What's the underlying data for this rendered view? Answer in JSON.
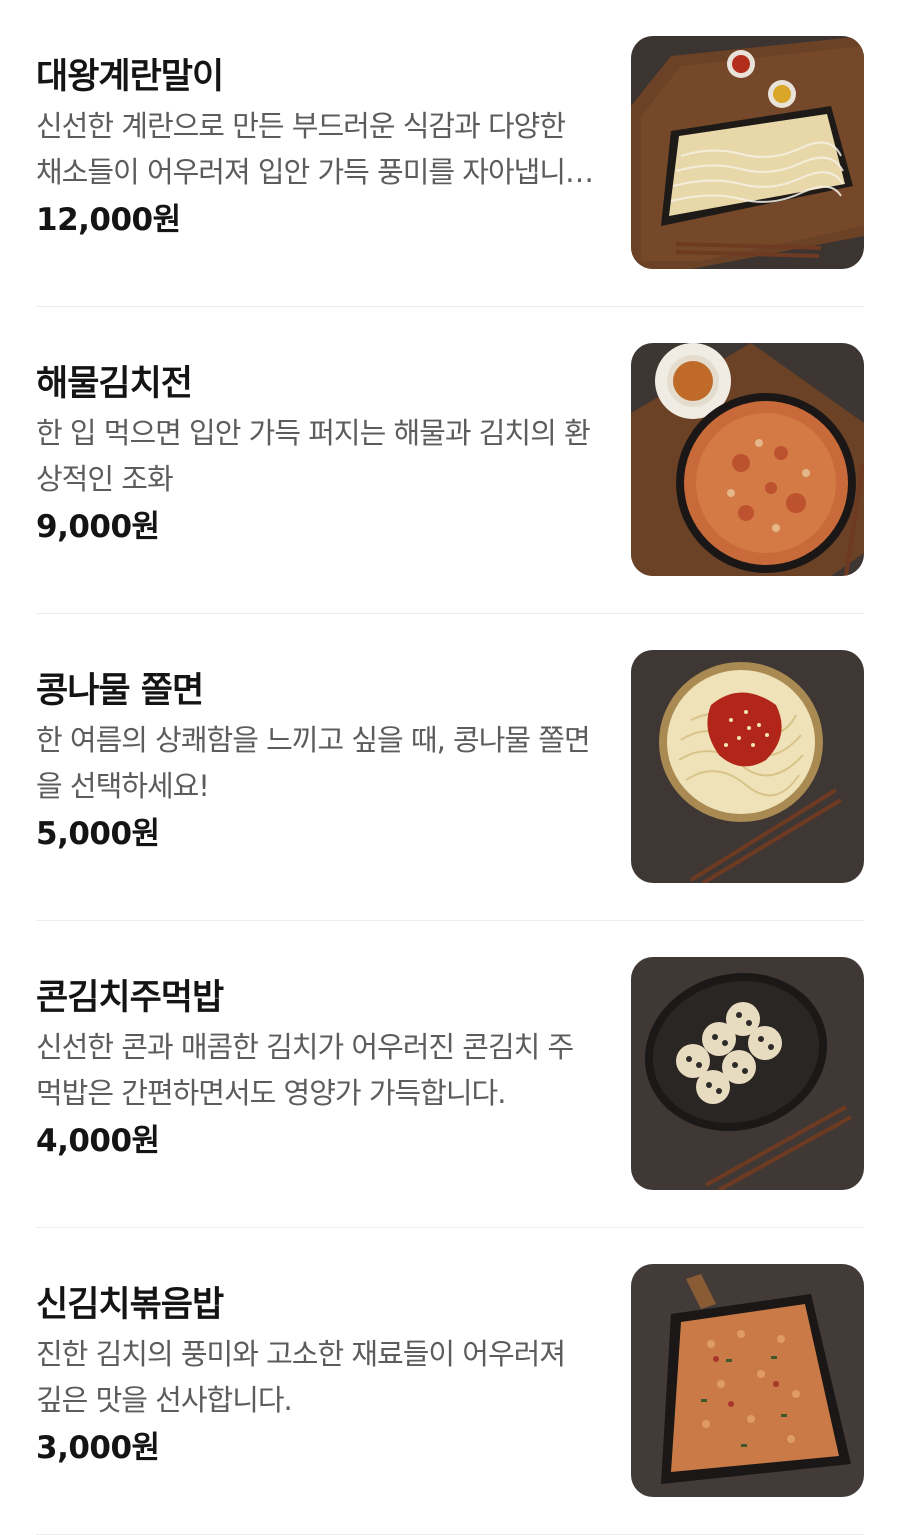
{
  "menu": {
    "items": [
      {
        "name": "대왕계란말이",
        "description": "신선한 계란으로 만든 부드러운 식감과 다양한 채소들이 어우러져 입안 가득 풍미를 자아냅니다.",
        "price": "12,000원",
        "image_icon": "rolled-omelette-photo"
      },
      {
        "name": "해물김치전",
        "description": "한 입 먹으면 입안 가득 퍼지는 해물과 김치의 환상적인 조화",
        "price": "9,000원",
        "image_icon": "seafood-kimchi-pancake-photo"
      },
      {
        "name": "콩나물 쫄면",
        "description": "한 여름의 상쾌함을 느끼고 싶을 때, 콩나물 쫄면을 선택하세요!",
        "price": "5,000원",
        "image_icon": "spicy-chewy-noodles-photo"
      },
      {
        "name": "콘김치주먹밥",
        "description": "신선한 콘과 매콤한 김치가 어우러진 콘김치 주먹밥은 간편하면서도 영양가 가득합니다.",
        "price": "4,000원",
        "image_icon": "rice-balls-photo"
      },
      {
        "name": "신김치볶음밥",
        "description": "진한 김치의 풍미와 고소한 재료들이 어우러져 깊은 맛을 선사합니다.",
        "price": "3,000원",
        "image_icon": "kimchi-fried-rice-photo"
      }
    ]
  },
  "colors": {
    "background": "#ffffff",
    "name_text": "#141414",
    "description_text": "#5c5c5c",
    "divider": "#ececec",
    "photo_background": "#3a3330"
  }
}
